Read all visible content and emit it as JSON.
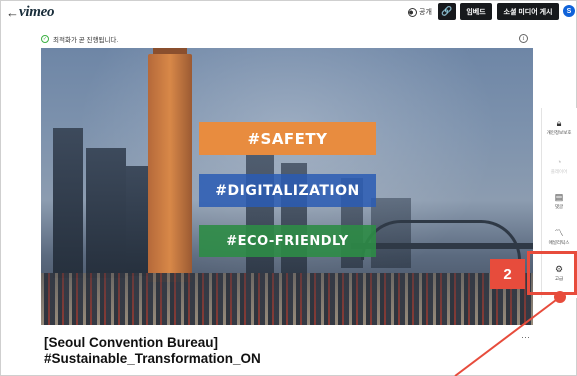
{
  "header": {
    "back_label": "←",
    "logo": "vimeo",
    "privacy_label": "공개",
    "link_icon": "link-icon",
    "embed_label": "임베드",
    "social_label": "소셜 미디어 게시",
    "user_initial": "S"
  },
  "status": {
    "text": "최적화가 곧 진행됩니다.",
    "check_icon": "check-circle-icon",
    "info_icon": "info-icon"
  },
  "video": {
    "tags": [
      "#SAFETY",
      "#DIGITALIZATION",
      "#ECO-FRIENDLY"
    ]
  },
  "title": {
    "line1": "[Seoul Convention Bureau]",
    "line2": "#Sustainable_Transformation_ON"
  },
  "more_label": "⋯",
  "sidebar": {
    "items": [
      {
        "icon": "lock-icon",
        "label": "개인정보보호"
      },
      {
        "icon": "palette-icon",
        "label": "플레이어"
      },
      {
        "icon": "comment-icon",
        "label": "댓글"
      },
      {
        "icon": "analytics-icon",
        "label": "애널리틱스"
      },
      {
        "icon": "gear-icon",
        "label": "고급"
      }
    ]
  },
  "annotation": {
    "step": "2",
    "color": "#e74c3c"
  }
}
